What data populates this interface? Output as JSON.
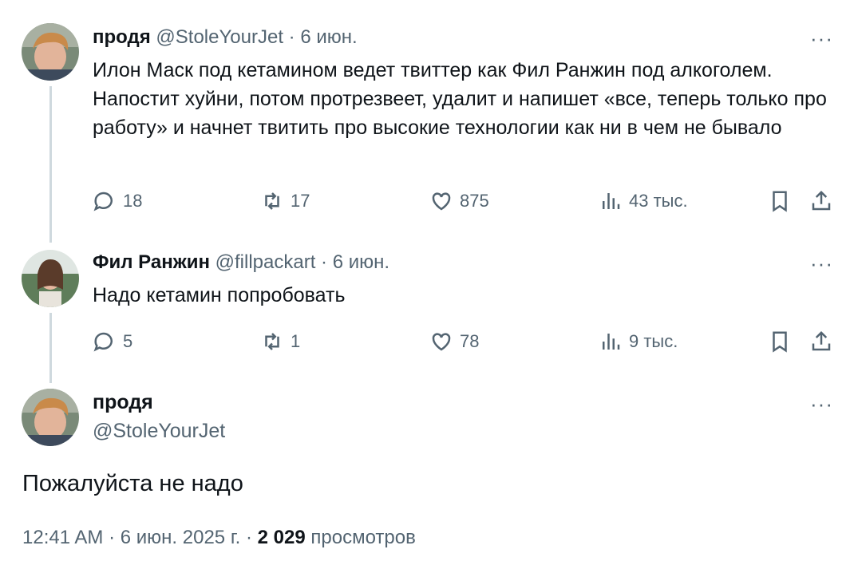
{
  "tweets": [
    {
      "name": "продя",
      "handle": "@StoleYourJet",
      "sep": "·",
      "date": "6 июн.",
      "text": "Илон Маск под кетамином ведет твиттер как Фил Ранжин под алкоголем. Напостит хуйни, потом протрезвеет, удалит и напишет «все, теперь только про работу» и начнет твитить про высокие технологии как ни в чем не бывало",
      "replies": "18",
      "retweets": "17",
      "likes": "875",
      "views": "43 тыс.",
      "more": "···"
    },
    {
      "name": "Фил Ранжин",
      "handle": "@fillpackart",
      "sep": "·",
      "date": "6 июн.",
      "text": "Надо кетамин попробовать",
      "replies": "5",
      "retweets": "1",
      "likes": "78",
      "views": "9 тыс.",
      "more": "···"
    }
  ],
  "main": {
    "name": "продя",
    "handle": "@StoleYourJet",
    "text": "Пожалуйста не надо",
    "time": "12:41 AM",
    "sep1": "·",
    "date": "6 июн. 2025 г.",
    "sep2": "·",
    "views_count": "2 029",
    "views_label": "просмотров",
    "more": "···"
  },
  "icons": [
    "reply-icon",
    "retweet-icon",
    "like-icon",
    "views-icon",
    "bookmark-icon",
    "share-icon",
    "more-icon"
  ]
}
